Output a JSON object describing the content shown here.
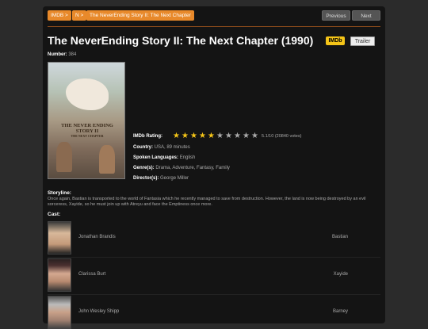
{
  "breadcrumbs": [
    "IMDB >",
    "N >",
    "The NeverEnding Story II: The Next Chapter"
  ],
  "nav": {
    "previous": "Previous",
    "next": "Next"
  },
  "movie": {
    "title": "The NeverEnding Story II: The Next Chapter (1990)",
    "imdb_badge": "IMDb",
    "trailer": "Trailer",
    "number_label": "Number:",
    "number": "384",
    "poster_title": "THE NEVER ENDING STORY II",
    "poster_subtitle": "THE NEXT CHAPTER",
    "rating_label": "IMDb Rating:",
    "rating_value": 5.1,
    "rating_text": "5.1/10 (20840 votes)",
    "country_label": "Country:",
    "country": "USA, 89 minutes",
    "languages_label": "Spoken Languages:",
    "languages": "English",
    "genres_label": "Genre(s):",
    "genres": "Drama, Adventure, Fantasy, Family",
    "directors_label": "Director(s):",
    "directors": "George Miller",
    "storyline_label": "Storyline:",
    "storyline": "Once again, Bastian is transported to the world of Fantasia which he recently managed to save from destruction. However, the land is now being destroyed by an evil sorceress, Xayide, so he must join up with Atreyu and face the Emptiness once more.",
    "cast_label": "Cast:",
    "cast": [
      {
        "name": "Jonathan Brandis",
        "character": "Bastian"
      },
      {
        "name": "Clarissa Burt",
        "character": "Xayide"
      },
      {
        "name": "John Wesley Shipp",
        "character": "Barney"
      }
    ]
  },
  "colors": {
    "accent": "#e8892a",
    "star": "#f5c518",
    "imdb": "#f5c518"
  }
}
